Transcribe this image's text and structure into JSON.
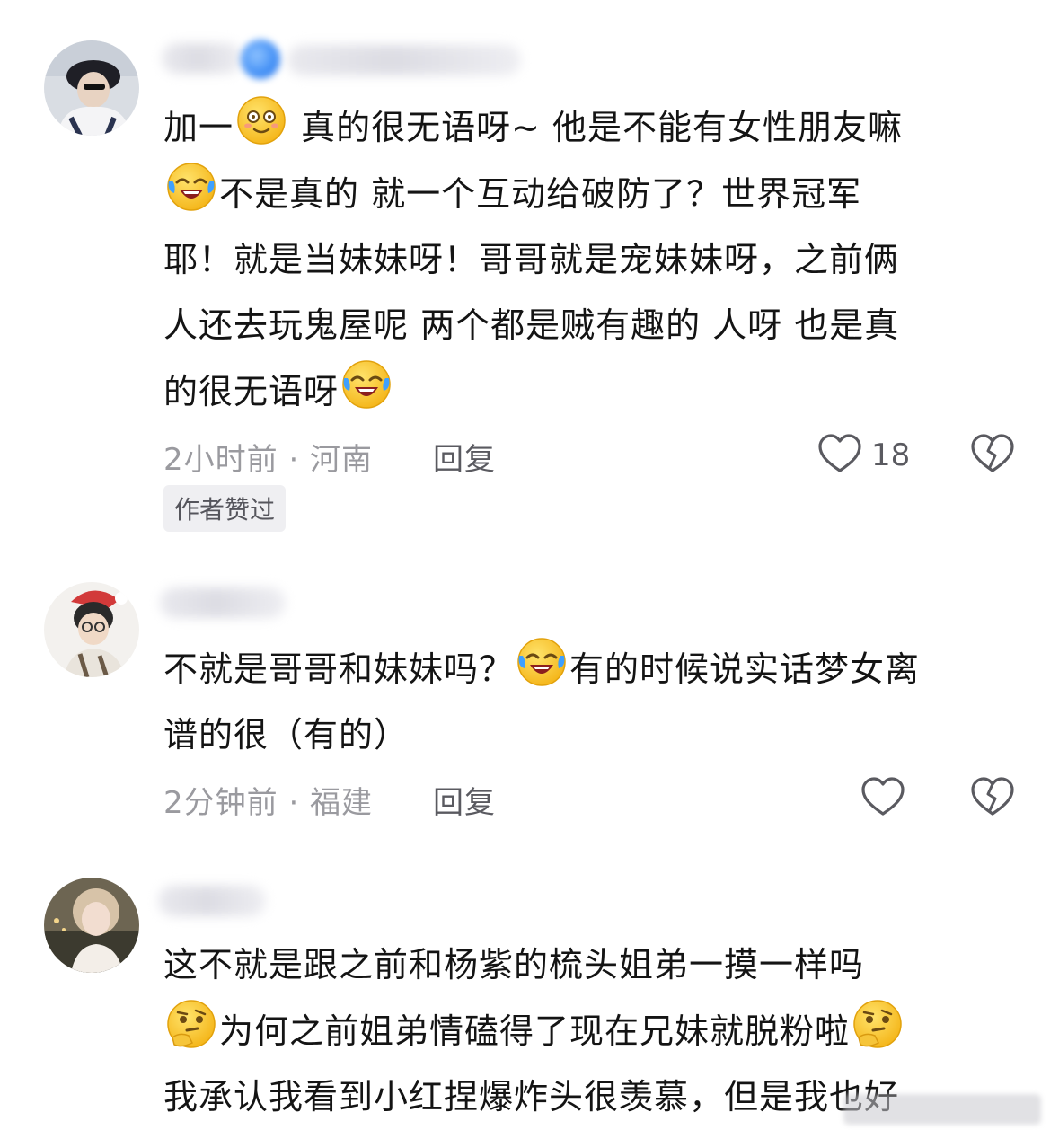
{
  "colors": {
    "text": "#141414",
    "meta": "#9a9a9f",
    "action": "#5a5a60",
    "badge_bg": "#efeff2"
  },
  "comments": [
    {
      "lines": [
        [
          "加一",
          "emoji:smile",
          " 真的很无语呀~ 他是不能有女性朋友嘛"
        ],
        [
          "emoji:laugh-cry",
          "不是真的  就一个互动给破防了？世界冠军"
        ],
        [
          "耶！就是当妹妹呀！哥哥就是宠妹妹呀，之前俩"
        ],
        [
          "人还去玩鬼屋呢  两个都是贼有趣的 人呀  也是真"
        ],
        [
          "的很无语呀",
          "emoji:laugh-cry"
        ]
      ],
      "time_location": "2小时前 · 河南",
      "reply_label": "回复",
      "like_count": "18",
      "author_badge": "作者赞过"
    },
    {
      "lines": [
        [
          "不就是哥哥和妹妹吗？",
          "emoji:laugh-cry",
          "有的时候说实话梦女离"
        ],
        [
          "谱的很（有的）"
        ]
      ],
      "time_location": "2分钟前 · 福建",
      "reply_label": "回复",
      "like_count": ""
    },
    {
      "lines": [
        [
          "这不就是跟之前和杨紫的梳头姐弟一摸一样吗"
        ],
        [
          "emoji:thinking",
          "为何之前姐弟情磕得了现在兄妹就脱粉啦",
          "emoji:thinking"
        ],
        [
          "我承认我看到小红捏爆炸头很羡慕，但是我也好"
        ]
      ]
    }
  ]
}
